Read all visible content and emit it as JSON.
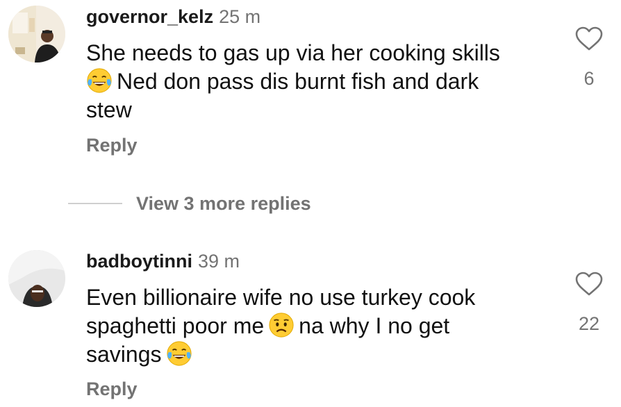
{
  "comments": [
    {
      "username": "governor_kelz",
      "time": "25 m",
      "text_line1": "She needs to gas up via her cooking skills",
      "text_part2": "Ned don pass dis burnt fish and dark",
      "text_line3": "stew",
      "emoji": "face-with-tears-of-joy",
      "reply_label": "Reply",
      "likes": "6"
    },
    {
      "username": "badboytinni",
      "time": "39 m",
      "text_line1": "Even billionaire wife no use turkey cook",
      "text_part2a": "spaghetti poor me",
      "text_part2b": "na why I no get",
      "text_line3": "savings",
      "emojis": [
        "worried-face",
        "face-with-tears-of-joy"
      ],
      "reply_label": "Reply",
      "likes": "22"
    }
  ],
  "view_replies": {
    "label": "View 3 more replies"
  },
  "colors": {
    "secondary_text": "#737373",
    "primary_text": "#111111",
    "divider": "#cfcfcf"
  }
}
